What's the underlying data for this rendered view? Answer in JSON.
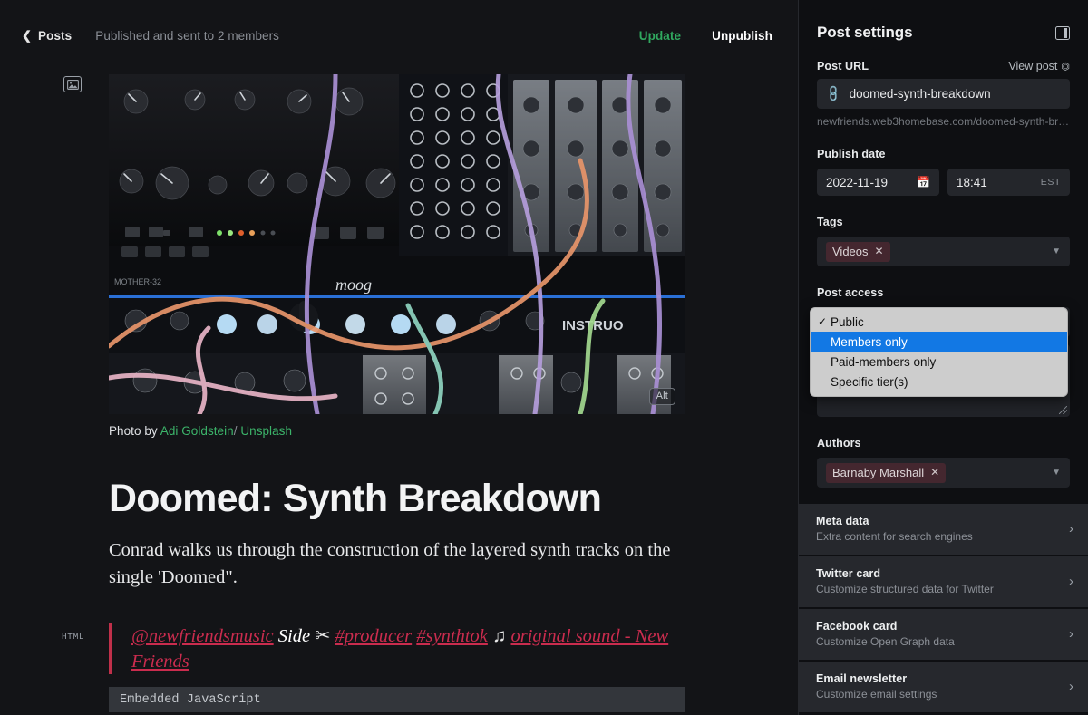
{
  "topbar": {
    "back_label": "Posts",
    "back_icon": "chevron-left-icon",
    "status": "Published and sent to 2 members",
    "update_label": "Update",
    "unpublish_label": "Unpublish"
  },
  "editor": {
    "feature_image": {
      "icon": "image-icon",
      "alt_badge": "Alt",
      "caption_prefix": "Photo by",
      "caption_author": "Adi Goldstein",
      "caption_sep": "/",
      "caption_source": "Unsplash"
    },
    "title": "Doomed: Synth Breakdown",
    "excerpt": "Conrad walks us through the construction of the layered synth tracks on the single 'Doomed\".",
    "html_card": {
      "label": "HTML",
      "quote_part1": "@newfriendsmusic",
      "quote_part2": "Side",
      "quote_emoji1": "✂",
      "quote_part3": "#producer",
      "quote_part4": "#synthtok",
      "quote_emoji2": "♫",
      "quote_part5": "original sound - New Friends",
      "embed_label": "Embedded JavaScript"
    }
  },
  "sidebar": {
    "title": "Post settings",
    "panel_icon": "sidebar-toggle-icon",
    "post_url": {
      "label": "Post URL",
      "view_post": "View post",
      "view_post_icon": "external-link-icon",
      "link_icon": "link-icon",
      "value": "doomed-synth-breakdown",
      "full_url": "newfriends.web3homebase.com/doomed-synth-bre…"
    },
    "publish_date": {
      "label": "Publish date",
      "date": "2022-11-19",
      "date_icon": "calendar-icon",
      "time": "18:41",
      "timezone": "EST"
    },
    "tags": {
      "label": "Tags",
      "chips": [
        "Videos"
      ],
      "remove_icon": "close-icon",
      "caret_icon": "chevron-down-icon"
    },
    "post_access": {
      "label": "Post access",
      "selected": "Public",
      "options": [
        {
          "label": "Public",
          "checked": true,
          "highlighted": false
        },
        {
          "label": "Members only",
          "checked": false,
          "highlighted": true
        },
        {
          "label": "Paid-members only",
          "checked": false,
          "highlighted": false
        },
        {
          "label": "Specific tier(s)",
          "checked": false,
          "highlighted": false
        }
      ]
    },
    "excerpt_field": {
      "value": ""
    },
    "authors": {
      "label": "Authors",
      "chips": [
        "Barnaby Marshall"
      ],
      "remove_icon": "close-icon",
      "caret_icon": "chevron-down-icon"
    },
    "sections": [
      {
        "title": "Meta data",
        "subtitle": "Extra content for search engines",
        "chevron": "chevron-right-icon"
      },
      {
        "title": "Twitter card",
        "subtitle": "Customize structured data for Twitter",
        "chevron": "chevron-right-icon"
      },
      {
        "title": "Facebook card",
        "subtitle": "Customize Open Graph data",
        "chevron": "chevron-right-icon"
      },
      {
        "title": "Email newsletter",
        "subtitle": "Customize email settings",
        "chevron": "chevron-right-icon"
      }
    ]
  },
  "colors": {
    "accent_green": "#30a85f",
    "link_green": "#3cb46a",
    "quote_red": "#ca2c4e",
    "highlight_blue": "#1278e4",
    "chip_bg": "#44272f"
  }
}
